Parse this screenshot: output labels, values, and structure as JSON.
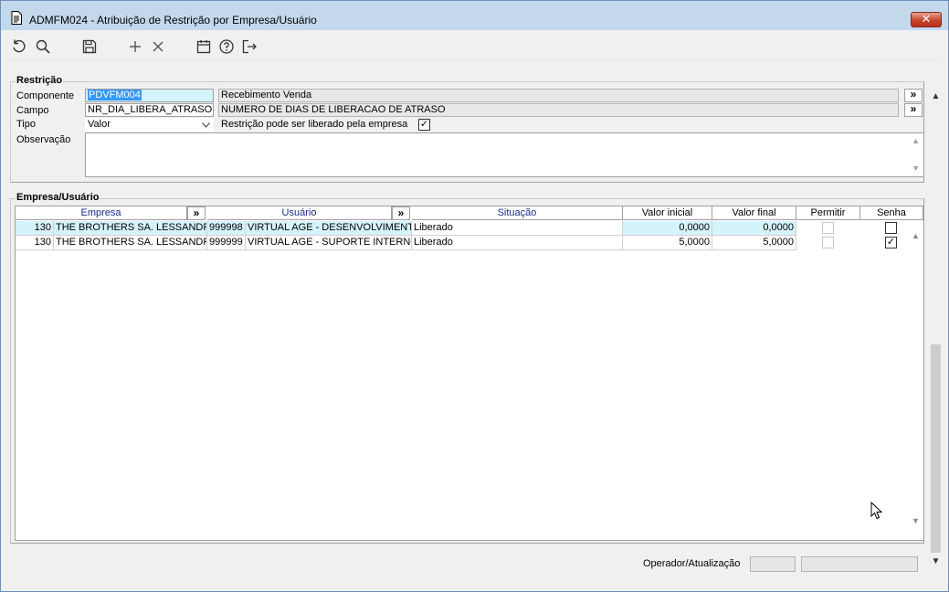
{
  "window": {
    "title": "ADMFM024 - Atribuição de Restrição por Empresa/Usuário",
    "close_label": "✕"
  },
  "toolbar": {
    "buttons": [
      {
        "name": "refresh-icon"
      },
      {
        "name": "search-icon"
      },
      {
        "name": "save-icon"
      },
      {
        "name": "add-icon"
      },
      {
        "name": "delete-icon"
      },
      {
        "name": "calendar-icon"
      },
      {
        "name": "help-icon"
      },
      {
        "name": "exit-icon"
      }
    ]
  },
  "restricao": {
    "group_label": "Restrição",
    "componente_label": "Componente",
    "componente_value": "PDVFM004",
    "componente_desc": "Recebimento Venda",
    "campo_label": "Campo",
    "campo_value": "NR_DIA_LIBERA_ATRASO",
    "campo_desc": "NUMERO DE DIAS DE LIBERACAO DE ATRASO",
    "tipo_label": "Tipo",
    "tipo_value": "Valor",
    "liberado_label": "Restrição pode ser liberado pela empresa",
    "liberado_checked": "✓",
    "observacao_label": "Observação",
    "lookup_label": "»"
  },
  "empresa_usuario": {
    "group_label": "Empresa/Usuário",
    "columns": {
      "empresa": "Empresa",
      "usuario": "Usuário",
      "situacao": "Situação",
      "valor_inicial": "Valor inicial",
      "valor_final": "Valor final",
      "permitir": "Permitir",
      "senha": "Senha"
    },
    "lookup_label": "»",
    "rows": [
      {
        "empresa_cod": "130",
        "empresa_nome": "THE BROTHERS SA. LESSANDRO",
        "usuario_cod": "999998",
        "usuario_nome": "VIRTUAL AGE - DESENVOLVIMENTO",
        "situacao": "Liberado",
        "valor_inicial": "0,0000",
        "valor_final": "0,0000",
        "senha": ""
      },
      {
        "empresa_cod": "130",
        "empresa_nome": "THE BROTHERS SA. LESSANDRO",
        "usuario_cod": "999999",
        "usuario_nome": "VIRTUAL AGE - SUPORTE INTERNO C",
        "situacao": "Liberado",
        "valor_inicial": "5,0000",
        "valor_final": "5,0000",
        "senha": "✓"
      }
    ]
  },
  "status": {
    "operador_label": "Operador/Atualização"
  },
  "colors": {
    "titlebar": "#c4d8ec",
    "selected_row": "#d4f3fb",
    "header_blue": "#1a2a8a"
  }
}
